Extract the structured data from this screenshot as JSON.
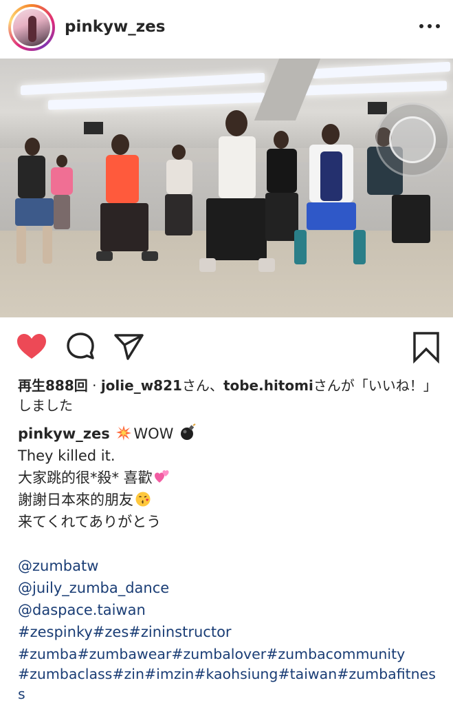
{
  "header": {
    "username": "pinkyw_zes",
    "avatar_icon": "profile-photo",
    "more_icon": "more-dots-icon"
  },
  "actions": {
    "like_icon": "heart-filled-icon",
    "comment_icon": "comment-icon",
    "share_icon": "paper-plane-icon",
    "save_icon": "bookmark-icon",
    "like_color": "#ed4956"
  },
  "likes": {
    "views": "再生888回",
    "separator": " · ",
    "user1": "jolie_w821",
    "middle": "さん、",
    "user2": "tobe.hitomi",
    "suffix": "さんが「いいね！」しました"
  },
  "caption": {
    "username": "pinkyw_zes",
    "first_text": "WOW",
    "line2": "They killed it.",
    "line3": "大家跳的很*殺* 喜歡",
    "line4": "謝謝日本來的朋友",
    "line5": "来てくれてありがとう",
    "mention1": "@zumbatw",
    "mention2": "@juily_zumba_dance",
    "mention3": "@daspace.taiwan",
    "tags1": "#zespinky#zes#zininstructor",
    "tags2": "#zumba#zumbawear#zumbalover#zumbacommunity",
    "tags3": "#zumbaclass#zin#imzin#kaohsiung#taiwan#zumbafitness",
    "emojis": [
      "collision-emoji",
      "bomb-emoji",
      "two-hearts-emoji",
      "kissing-face-emoji"
    ],
    "link_color": "#1a3d75"
  }
}
